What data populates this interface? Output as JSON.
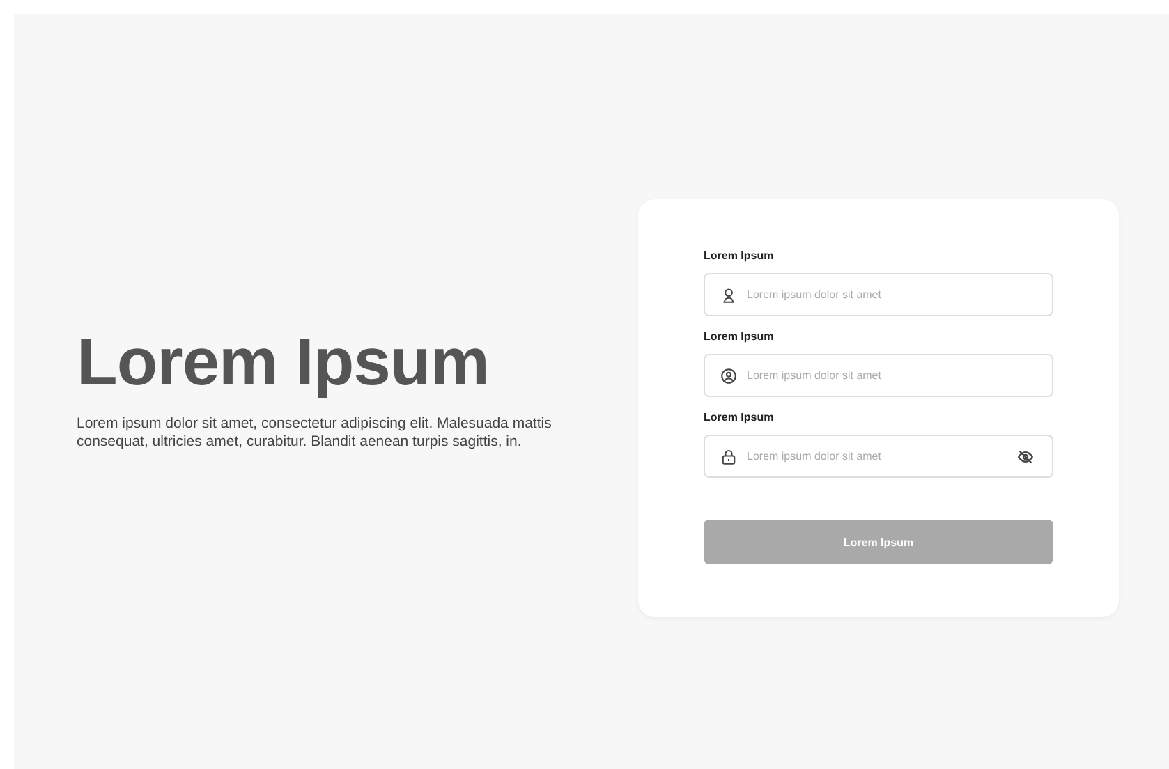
{
  "hero": {
    "title": "Lorem Ipsum",
    "text": "Lorem ipsum dolor sit amet, consectetur adipiscing elit. Malesuada mattis consequat, ultricies amet, curabitur. Blandit aenean turpis sagittis, in."
  },
  "form": {
    "fields": [
      {
        "label": "Lorem Ipsum",
        "placeholder": "Lorem ipsum dolor sit amet",
        "kind": "text"
      },
      {
        "label": "Lorem Ipsum",
        "placeholder": "Lorem ipsum dolor sit amet",
        "kind": "text"
      },
      {
        "label": "Lorem Ipsum",
        "placeholder": "Lorem ipsum dolor sit amet",
        "kind": "password"
      }
    ],
    "submit": {
      "label": "Lorem Ipsum",
      "disabled": true
    }
  }
}
